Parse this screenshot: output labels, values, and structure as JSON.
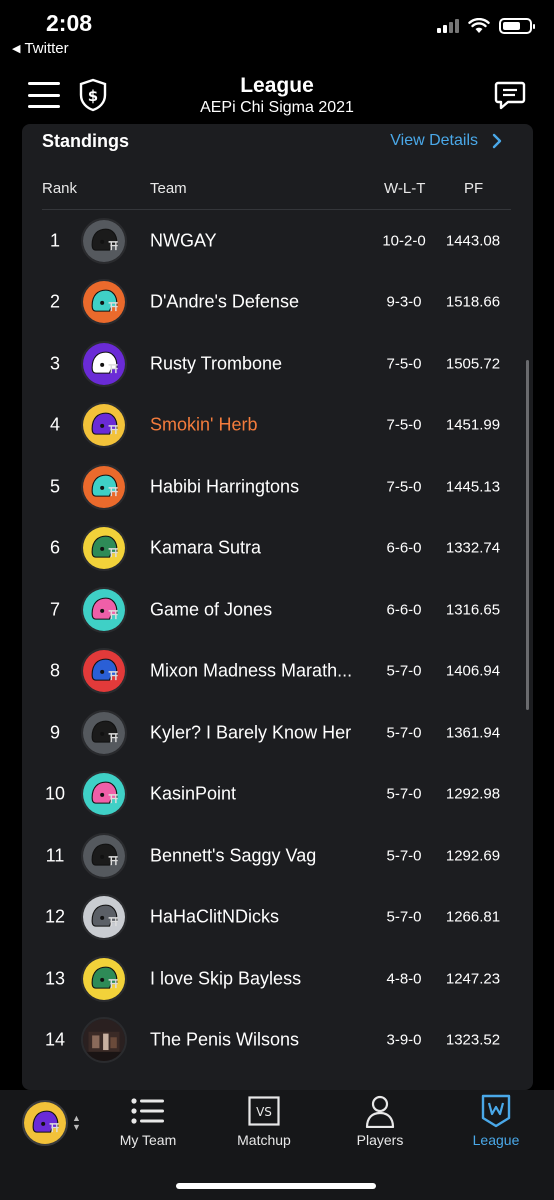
{
  "status_bar": {
    "time": "2:08",
    "back_app": "Twitter"
  },
  "header": {
    "title": "League",
    "subtitle": "AEPi Chi Sigma 2021"
  },
  "standings": {
    "title": "Standings",
    "view_details": "View Details",
    "columns": {
      "rank": "Rank",
      "team": "Team",
      "wlt": "W-L-T",
      "pf": "PF"
    },
    "rows": [
      {
        "rank": "1",
        "team": "NWGAY",
        "wlt": "10-2-0",
        "pf": "1443.08",
        "helmet": "#1b1b1b",
        "bg": "#55595e",
        "highlight": false
      },
      {
        "rank": "2",
        "team": "D'Andre's Defense",
        "wlt": "9-3-0",
        "pf": "1518.66",
        "helmet": "#3fd0c6",
        "bg": "#ea6a2c",
        "highlight": false
      },
      {
        "rank": "3",
        "team": "Rusty Trombone",
        "wlt": "7-5-0",
        "pf": "1505.72",
        "helmet": "#ffffff",
        "bg": "#6a2bd6",
        "highlight": false
      },
      {
        "rank": "4",
        "team": "Smokin' Herb",
        "wlt": "7-5-0",
        "pf": "1451.99",
        "helmet": "#6a2bd6",
        "bg": "#f2c23a",
        "highlight": true
      },
      {
        "rank": "5",
        "team": "Habibi Harringtons",
        "wlt": "7-5-0",
        "pf": "1445.13",
        "helmet": "#3fd0c6",
        "bg": "#ea6a2c",
        "highlight": false
      },
      {
        "rank": "6",
        "team": "Kamara Sutra",
        "wlt": "6-6-0",
        "pf": "1332.74",
        "helmet": "#2e8b57",
        "bg": "#f2d23a",
        "highlight": false
      },
      {
        "rank": "7",
        "team": "Game of Jones",
        "wlt": "6-6-0",
        "pf": "1316.65",
        "helmet": "#ef5fa8",
        "bg": "#3fd0c6",
        "highlight": false
      },
      {
        "rank": "8",
        "team": "Mixon Madness Marath...",
        "wlt": "5-7-0",
        "pf": "1406.94",
        "helmet": "#2a5fd6",
        "bg": "#e23a3a",
        "highlight": false
      },
      {
        "rank": "9",
        "team": "Kyler? I Barely Know Her",
        "wlt": "5-7-0",
        "pf": "1361.94",
        "helmet": "#1b1b1b",
        "bg": "#55595e",
        "highlight": false
      },
      {
        "rank": "10",
        "team": "KasinPoint",
        "wlt": "5-7-0",
        "pf": "1292.98",
        "helmet": "#ef5fa8",
        "bg": "#3fd0c6",
        "highlight": false
      },
      {
        "rank": "11",
        "team": "Bennett's Saggy Vag",
        "wlt": "5-7-0",
        "pf": "1292.69",
        "helmet": "#1b1b1b",
        "bg": "#55595e",
        "highlight": false
      },
      {
        "rank": "12",
        "team": "HaHaClitNDicks",
        "wlt": "5-7-0",
        "pf": "1266.81",
        "helmet": "#5b5f66",
        "bg": "#c9ccd1",
        "highlight": false
      },
      {
        "rank": "13",
        "team": "I love Skip Bayless",
        "wlt": "4-8-0",
        "pf": "1247.23",
        "helmet": "#2e8b57",
        "bg": "#f2d23a",
        "highlight": false
      },
      {
        "rank": "14",
        "team": "The Penis Wilsons",
        "wlt": "3-9-0",
        "pf": "1323.52",
        "helmet": "photo",
        "bg": "#2a2020",
        "highlight": false
      }
    ]
  },
  "bottom_nav": {
    "items": [
      {
        "label": "My Team",
        "icon": "list-icon",
        "active": false
      },
      {
        "label": "Matchup",
        "icon": "vs-icon",
        "active": false
      },
      {
        "label": "Players",
        "icon": "person-icon",
        "active": false
      },
      {
        "label": "League",
        "icon": "league-icon",
        "active": true
      }
    ]
  },
  "colors": {
    "accent": "#4aa8e8",
    "highlight": "#f47c3c",
    "card": "#1c1d20",
    "background": "#000000"
  }
}
